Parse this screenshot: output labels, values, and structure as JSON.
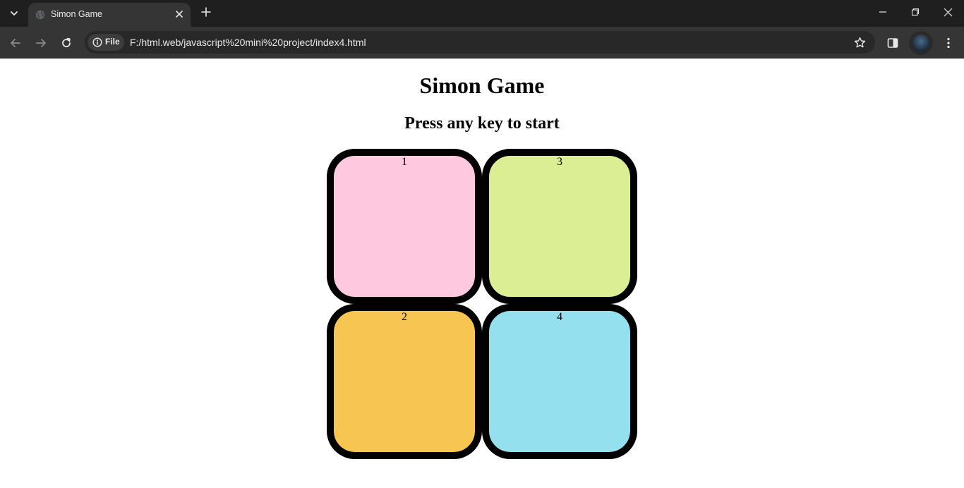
{
  "browser": {
    "tab": {
      "title": "Simon Game"
    },
    "address_bar": {
      "site_chip_label": "File",
      "url": "F:/html.web/javascript%20mini%20project/index4.html"
    }
  },
  "page": {
    "title": "Simon Game",
    "subtitle": "Press any key to start",
    "pads": [
      {
        "number": "1",
        "color": "#fec9de"
      },
      {
        "number": "2",
        "color": "#f7c652"
      },
      {
        "number": "3",
        "color": "#dbee94"
      },
      {
        "number": "4",
        "color": "#94e0ef"
      }
    ]
  },
  "colors": {
    "titlebar_bg": "#1f1f1f",
    "toolbar_bg": "#353535",
    "omnibox_bg": "#282828",
    "pad_border": "#000000"
  }
}
